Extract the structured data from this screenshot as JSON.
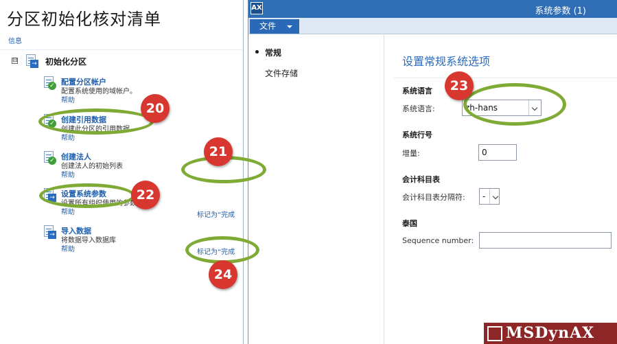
{
  "left_panel": {
    "title": "分区初始化核对清单",
    "info_link": "信息",
    "collapse_symbol": "⊟",
    "root_label": "初始化分区",
    "tasks": [
      {
        "name": "配置分区帐户",
        "description": "配置系统使用的域帐户。",
        "help": "帮助",
        "icon": "checklist-done-icon"
      },
      {
        "name": "创建引用数据",
        "description": "创建此分区的引用数据。",
        "help": "帮助",
        "icon": "checklist-done-icon"
      },
      {
        "name": "创建法人",
        "description": "创建法人的初始列表",
        "help": "帮助",
        "icon": "checklist-done-icon"
      },
      {
        "name": "设置系统参数",
        "description": "设置所有组织使用的参数",
        "help": "帮助",
        "icon": "checklist-arrow-icon"
      },
      {
        "name": "导入数据",
        "description": "将数据导入数据库",
        "help": "帮助",
        "icon": "checklist-arrow-icon"
      }
    ],
    "mark_complete": "标记为“完成"
  },
  "dialog": {
    "app_icon": "AX",
    "window_title": "系统参数 (1)",
    "file_button": "文件",
    "nav": [
      "常规",
      "文件存储"
    ],
    "content_title": "设置常规系统选项",
    "groups": {
      "language": {
        "heading": "系统语言",
        "label": "系统语言:",
        "value": "zh-hans"
      },
      "line_number": {
        "heading": "系统行号",
        "label": "增量:",
        "value": "0"
      },
      "chart_of_accounts": {
        "heading": "会计科目表",
        "label": "会计科目表分隔符:",
        "value": "-"
      },
      "thailand": {
        "heading": "泰国",
        "label": "Sequence number:",
        "value": ""
      }
    }
  },
  "annotations": [
    "20",
    "21",
    "22",
    "23",
    "24"
  ],
  "watermark": "MSDynAX",
  "colors": {
    "ring": "#7faa35",
    "badge": "#d8372f",
    "titlebar": "#2f6db5",
    "link": "#1f5fae"
  }
}
